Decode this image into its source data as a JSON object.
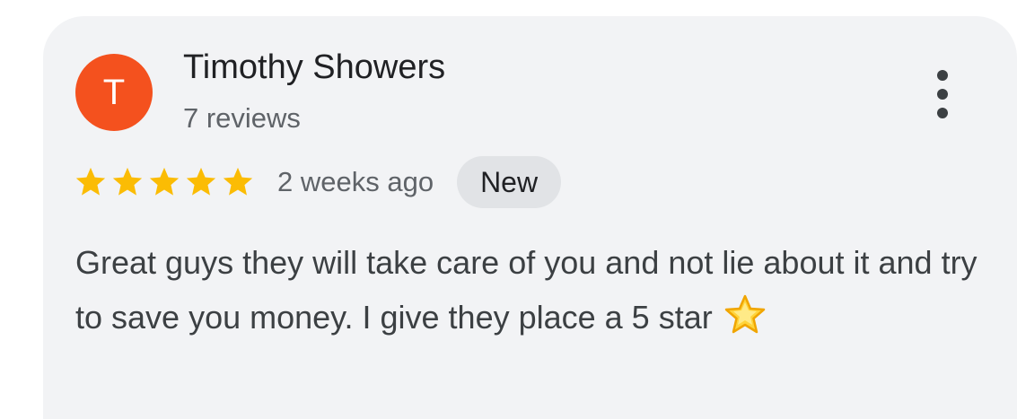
{
  "review": {
    "avatar_initial": "T",
    "avatar_color": "#f4511e",
    "reviewer_name": "Timothy Showers",
    "reviewer_reviews": "7 reviews",
    "rating": 5,
    "rating_max": 5,
    "star_color": "#fbbc04",
    "time_ago": "2 weeks ago",
    "badge": "New",
    "text": "Great guys they will take care of you and not lie about it and try to save you money. I give they place a 5 star",
    "text_emoji_icon": "glowing-star-icon",
    "menu_icon": "more-vert-icon"
  }
}
